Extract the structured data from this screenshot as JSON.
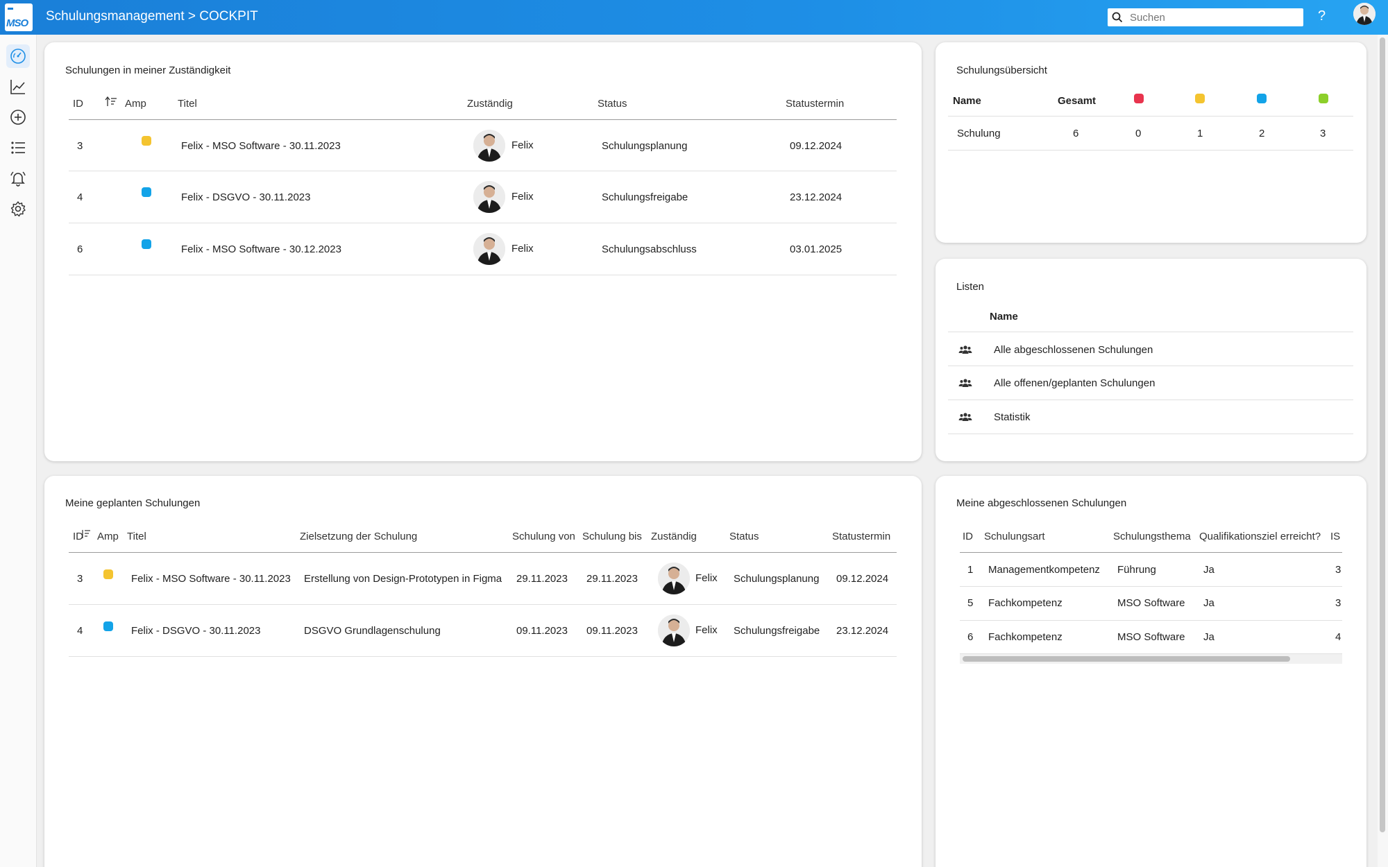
{
  "header": {
    "logo_text": "MSO",
    "title": "Schulungsmanagement > COCKPIT",
    "search_placeholder": "Suchen",
    "help_label": "?"
  },
  "colors": {
    "yellow": "#f4c430",
    "blue": "#13a3e8",
    "red": "#e8344e",
    "green": "#8ccf2a",
    "accent": "#1e8fe6"
  },
  "sidebar": {
    "items": [
      {
        "icon": "speedometer-icon",
        "active": true
      },
      {
        "icon": "line-chart-icon",
        "active": false
      },
      {
        "icon": "plus-circle-icon",
        "active": false
      },
      {
        "icon": "list-icon",
        "active": false
      },
      {
        "icon": "alarm-bell-icon",
        "active": false
      },
      {
        "icon": "gear-icon",
        "active": false
      }
    ]
  },
  "responsibility": {
    "title": "Schulungen in meiner Zuständigkeit",
    "headers": {
      "id": "ID",
      "amp": "Amp",
      "titel": "Titel",
      "zustaendig": "Zuständig",
      "status": "Status",
      "statustermin": "Statustermin"
    },
    "rows": [
      {
        "id": "3",
        "amp": "yellow",
        "titel": "Felix - MSO Software - 30.11.2023",
        "zustaendig": "Felix",
        "status": "Schulungsplanung",
        "statustermin": "09.12.2024"
      },
      {
        "id": "4",
        "amp": "blue",
        "titel": "Felix - DSGVO - 30.11.2023",
        "zustaendig": "Felix",
        "status": "Schulungsfreigabe",
        "statustermin": "23.12.2024"
      },
      {
        "id": "6",
        "amp": "blue",
        "titel": "Felix - MSO Software - 30.12.2023",
        "zustaendig": "Felix",
        "status": "Schulungsabschluss",
        "statustermin": "03.01.2025"
      }
    ]
  },
  "overview": {
    "title": "Schulungsübersicht",
    "headers": {
      "name": "Name",
      "gesamt": "Gesamt"
    },
    "row": {
      "name": "Schulung",
      "gesamt": "6",
      "red": "0",
      "yellow": "1",
      "blue": "2",
      "green": "3"
    }
  },
  "lists": {
    "title": "Listen",
    "header": "Name",
    "items": [
      {
        "icon": "users-icon",
        "label": "Alle abgeschlossenen Schulungen"
      },
      {
        "icon": "users-icon",
        "label": "Alle offenen/geplanten Schulungen"
      },
      {
        "icon": "users-icon",
        "label": "Statistik"
      }
    ]
  },
  "planned": {
    "title": "Meine geplanten Schulungen",
    "headers": {
      "id": "ID",
      "amp": "Amp",
      "titel": "Titel",
      "ziel": "Zielsetzung der Schulung",
      "von": "Schulung von",
      "bis": "Schulung bis",
      "zustaendig": "Zuständig",
      "status": "Status",
      "statustermin": "Statustermin"
    },
    "rows": [
      {
        "id": "3",
        "amp": "yellow",
        "titel": "Felix - MSO Software - 30.11.2023",
        "ziel": "Erstellung von Design-Prototypen in Figma",
        "von": "29.11.2023",
        "bis": "29.11.2023",
        "zustaendig": "Felix",
        "status": "Schulungsplanung",
        "statustermin": "09.12.2024"
      },
      {
        "id": "4",
        "amp": "blue",
        "titel": "Felix - DSGVO - 30.11.2023",
        "ziel": "DSGVO Grundlagenschulung",
        "von": "09.11.2023",
        "bis": "09.11.2023",
        "zustaendig": "Felix",
        "status": "Schulungsfreigabe",
        "statustermin": "23.12.2024"
      }
    ]
  },
  "completed": {
    "title": "Meine abgeschlossenen Schulungen",
    "headers": {
      "id": "ID",
      "art": "Schulungsart",
      "thema": "Schulungsthema",
      "ziel": "Qualifikationsziel erreicht?",
      "ist": "IS"
    },
    "rows": [
      {
        "id": "1",
        "art": "Managementkompetenz",
        "thema": "Führung",
        "ziel": "Ja",
        "ist": "3"
      },
      {
        "id": "5",
        "art": "Fachkompetenz",
        "thema": "MSO Software",
        "ziel": "Ja",
        "ist": "3"
      },
      {
        "id": "6",
        "art": "Fachkompetenz",
        "thema": "MSO Software",
        "ziel": "Ja",
        "ist": "4"
      }
    ]
  }
}
